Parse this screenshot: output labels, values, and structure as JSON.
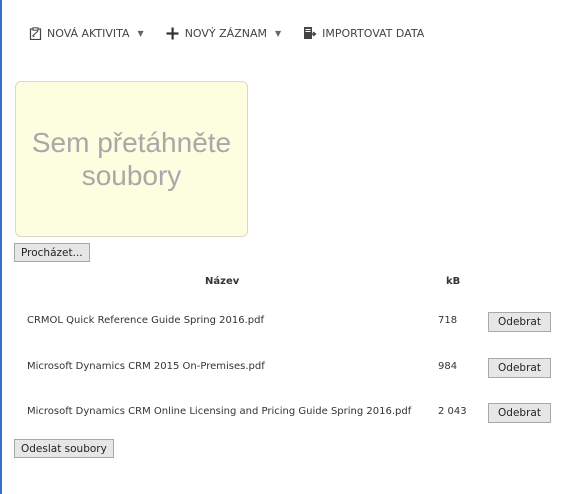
{
  "toolbar": {
    "new_activity": "NOVÁ AKTIVITA",
    "new_record": "NOVÝ ZÁZNAM",
    "import_data": "IMPORTOVAT DATA"
  },
  "dropzone": {
    "text": "Sem přetáhněte soubory"
  },
  "browse_button": "Procházet...",
  "table": {
    "headers": {
      "name": "Název",
      "size": "kB"
    },
    "rows": [
      {
        "name": "CRMOL Quick Reference Guide Spring 2016.pdf",
        "size": "718",
        "action": "Odebrat"
      },
      {
        "name": "Microsoft Dynamics CRM 2015 On-Premises.pdf",
        "size": "984",
        "action": "Odebrat"
      },
      {
        "name": "Microsoft Dynamics CRM Online Licensing and Pricing Guide Spring 2016.pdf",
        "size": "2 043",
        "action": "Odebrat"
      }
    ]
  },
  "send_button": "Odeslat soubory",
  "icons": {
    "new_activity": "clipboard-icon",
    "new_record": "plus-icon",
    "import_data": "import-icon"
  },
  "colors": {
    "frame": "#2f73c9",
    "dropzone_bg": "#fdfde0",
    "dropzone_text": "#a8a8a8"
  }
}
